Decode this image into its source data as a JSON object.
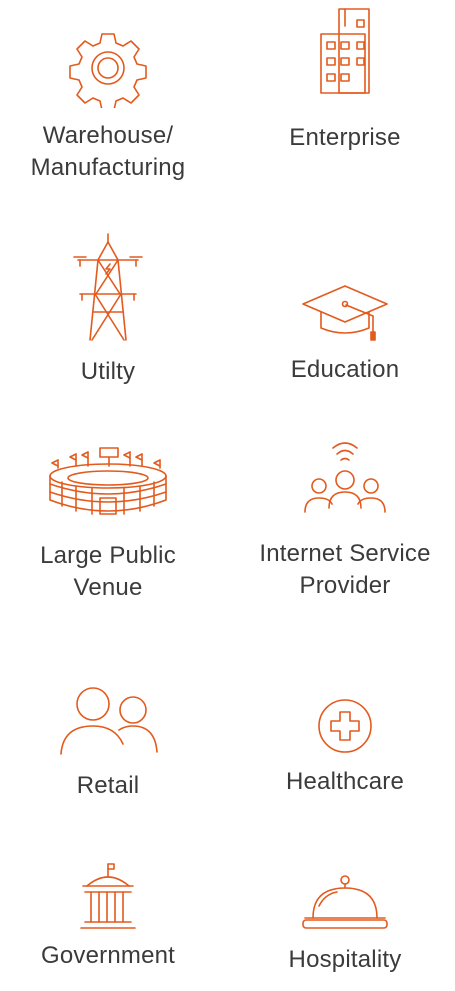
{
  "accent_color": "#e35a1d",
  "industries": [
    {
      "label_1": "Warehouse/",
      "label_2": "Manufacturing",
      "icon": "gear-icon"
    },
    {
      "label_1": "Enterprise",
      "label_2": "",
      "icon": "office-building-icon"
    },
    {
      "label_1": "Utilty",
      "label_2": "",
      "icon": "power-tower-icon"
    },
    {
      "label_1": "Education",
      "label_2": "",
      "icon": "graduation-cap-icon"
    },
    {
      "label_1": "Large Public",
      "label_2": "Venue",
      "icon": "stadium-icon"
    },
    {
      "label_1": "Internet Service",
      "label_2": "Provider",
      "icon": "connected-people-icon"
    },
    {
      "label_1": "Retail",
      "label_2": "",
      "icon": "people-icon"
    },
    {
      "label_1": "Healthcare",
      "label_2": "",
      "icon": "medical-cross-icon"
    },
    {
      "label_1": "Government",
      "label_2": "",
      "icon": "government-building-icon"
    },
    {
      "label_1": "Hospitality",
      "label_2": "",
      "icon": "service-bell-icon"
    }
  ]
}
